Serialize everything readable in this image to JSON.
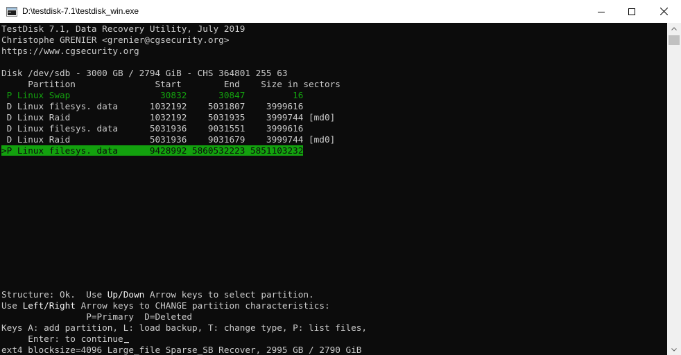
{
  "window": {
    "title": "D:\\testdisk-7.1\\testdisk_win.exe",
    "icon": "terminal-icon"
  },
  "colors": {
    "console_bg": "#0c0c0c",
    "text": "#cccccc",
    "bright_text": "#f2f2f2",
    "green": "#13a10e"
  },
  "console": {
    "header": [
      "TestDisk 7.1, Data Recovery Utility, July 2019",
      "Christophe GRENIER <grenier@cgsecurity.org>",
      "https://www.cgsecurity.org"
    ],
    "disk_info": "Disk /dev/sdb - 3000 GB / 2794 GiB - CHS 364801 255 63",
    "table_header": "     Partition               Start        End    Size in sectors",
    "rows": [
      {
        "text": " P Linux Swap                 30832      30847         16",
        "style": "green"
      },
      {
        "text": " D Linux filesys. data      1032192    5031807    3999616",
        "style": "normal"
      },
      {
        "text": " D Linux Raid               1032192    5031935    3999744 [md0]",
        "style": "normal"
      },
      {
        "text": " D Linux filesys. data      5031936    9031551    3999616",
        "style": "normal"
      },
      {
        "text": " D Linux Raid               5031936    9031679    3999744 [md0]",
        "style": "normal"
      },
      {
        "text": ">P Linux filesys. data      9428992 5860532223 5851103232",
        "style": "selected"
      }
    ],
    "help": {
      "l1_a": "Structure: Ok.  Use ",
      "l1_b": "Up/Down",
      "l1_c": " Arrow keys to select partition.",
      "l2_a": "Use ",
      "l2_b": "Left/Right",
      "l2_c": " Arrow keys to CHANGE partition characteristics:",
      "l3": "                P=Primary  D=Deleted",
      "l4": "Keys A: add partition, L: load backup, T: change type, P: list files,",
      "l5": "     Enter: to continue",
      "l6": "ext4 blocksize=4096 Large_file Sparse_SB Recover, 2995 GB / 2790 GiB"
    }
  }
}
